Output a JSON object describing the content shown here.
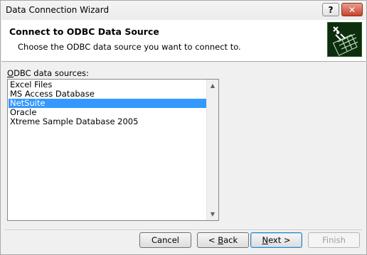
{
  "window": {
    "title": "Data Connection Wizard",
    "help_button": "?",
    "close_button": "✕"
  },
  "header": {
    "title": "Connect to ODBC Data Source",
    "subtitle": "Choose the ODBC data source you want to connect to."
  },
  "datasources": {
    "label_first_char": "O",
    "label_rest": "DBC data sources:",
    "items": [
      "Excel Files",
      "MS Access Database",
      "NetSuite",
      "Oracle",
      "Xtreme Sample Database 2005"
    ],
    "selected_index": 2
  },
  "buttons": {
    "cancel": "Cancel",
    "back_prefix": "< ",
    "back_accel": "B",
    "back_rest": "ack",
    "next_accel": "N",
    "next_rest": "ext >",
    "finish": "Finish"
  },
  "colors": {
    "selection": "#3399ff",
    "close_button": "#c7432d"
  }
}
